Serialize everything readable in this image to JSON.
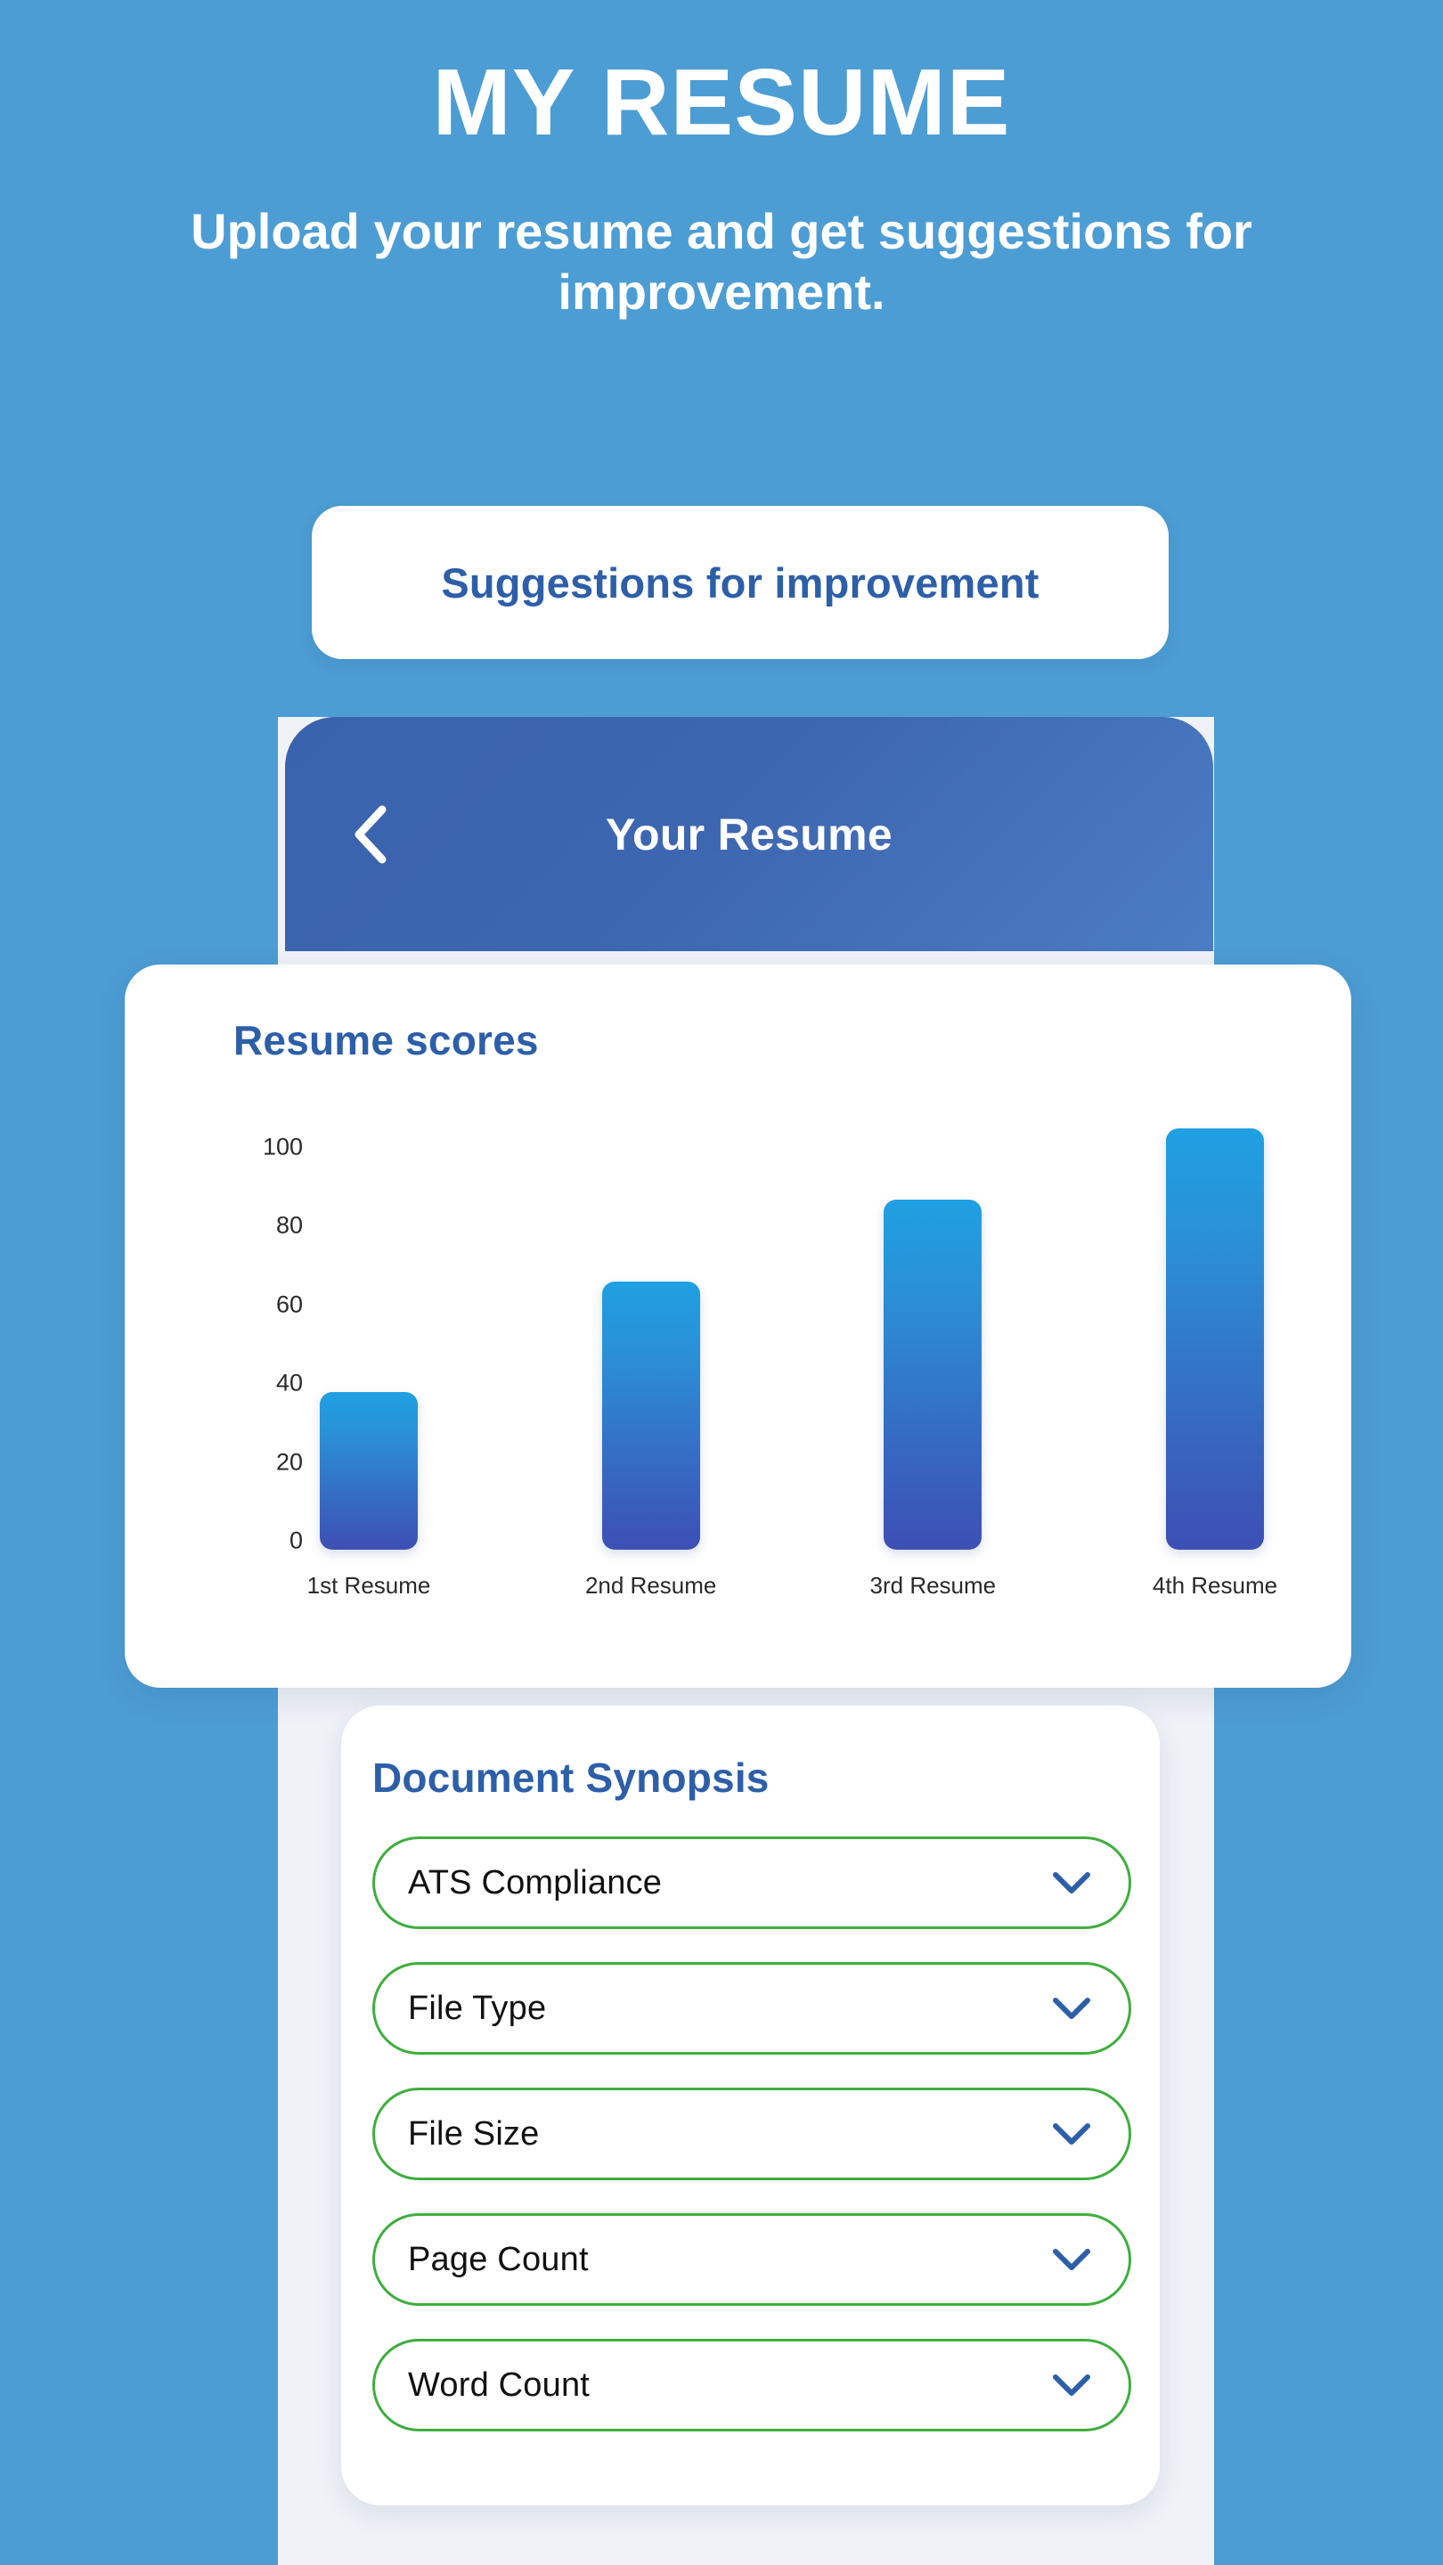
{
  "hero": {
    "title": "MY RESUME",
    "subtitle": "Upload your resume and get suggestions for improvement."
  },
  "suggestions_button": {
    "label": "Suggestions for improvement"
  },
  "resume_header": {
    "title": "Your Resume",
    "back_icon": "chevron-left-icon"
  },
  "scores_card": {
    "title": "Resume scores"
  },
  "chart_data": {
    "type": "bar",
    "title": "Resume scores",
    "categories": [
      "1st Resume",
      "2nd Resume",
      "3rd Resume",
      "4th Resume"
    ],
    "values": [
      40,
      68,
      89,
      107
    ],
    "xlabel": "",
    "ylabel": "",
    "ylim": [
      0,
      100
    ],
    "yticks": [
      100,
      80,
      60,
      40,
      20,
      0
    ],
    "grid": false,
    "legend": "none",
    "bar_gradient_top": "#1FA0E2",
    "bar_gradient_bottom": "#3D4FB4"
  },
  "synopsis": {
    "title": "Document Synopsis",
    "items": [
      {
        "label": "ATS Compliance",
        "chevron": "chevron-down-icon"
      },
      {
        "label": "File Type",
        "chevron": "chevron-down-icon"
      },
      {
        "label": "File Size",
        "chevron": "chevron-down-icon"
      },
      {
        "label": "Page Count",
        "chevron": "chevron-down-icon"
      },
      {
        "label": "Word Count",
        "chevron": "chevron-down-icon"
      }
    ]
  },
  "colors": {
    "background_blue": "#4C9DD4",
    "accent_blue": "#2D5FA9",
    "header_blue": "#3D66B0",
    "accordion_border_green": "#3FAE3F",
    "sheet_gray": "#EFF2F7"
  }
}
